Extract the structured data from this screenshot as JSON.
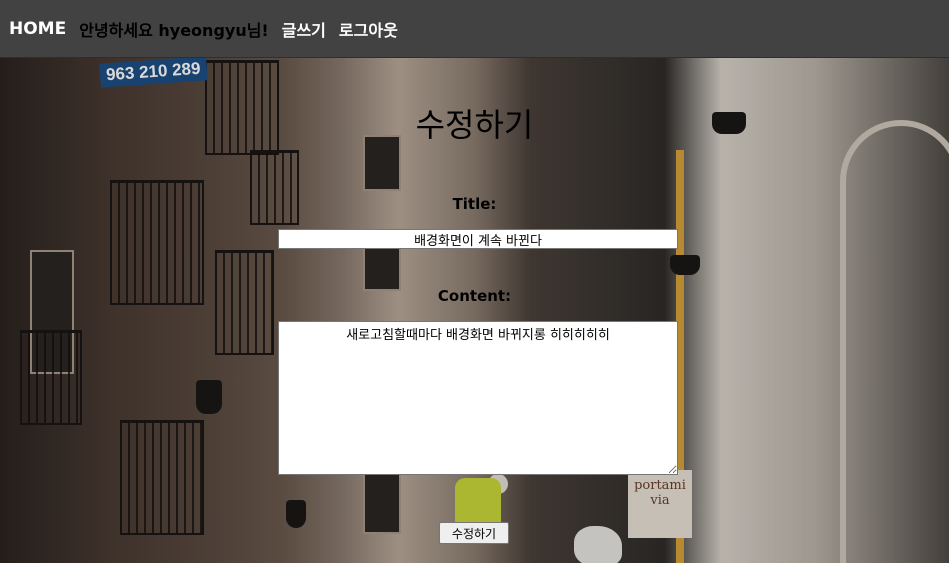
{
  "nav": {
    "home_label": "HOME",
    "greeting": "안녕하세요 hyeongyu님!",
    "write_label": "글쓰기",
    "logout_label": "로그아웃"
  },
  "form": {
    "heading": "수정하기",
    "title_label": "Title:",
    "title_value": "배경화면이 계속 바뀐다",
    "content_label": "Content:",
    "content_value": "새로고침할때마다 배경화면 바뀌지롱 히히히히히",
    "submit_label": "수정하기"
  },
  "background": {
    "sign_text": "963 210 289",
    "shop_sign_text": "portami via"
  },
  "colors": {
    "navbar": "#424242",
    "nav_link": "#ffffff",
    "greeting": "#000000"
  }
}
